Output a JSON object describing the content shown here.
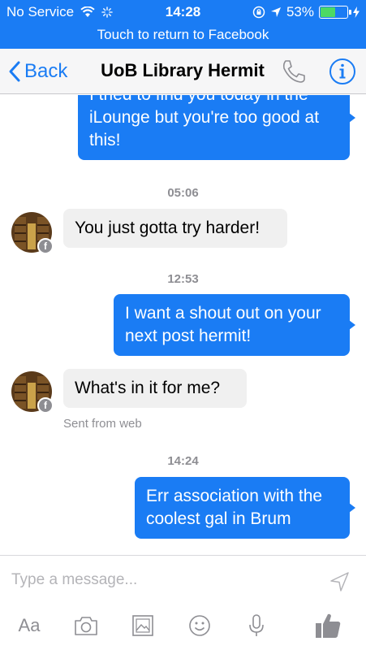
{
  "status_bar": {
    "carrier": "No Service",
    "time": "14:28",
    "battery": "53%",
    "battery_level": 0.53
  },
  "return_banner": "Touch to return to Facebook",
  "nav": {
    "back_label": "Back",
    "title": "UoB Library Hermit"
  },
  "messages": [
    {
      "from": "me",
      "text": "I tried to find you today in the iLounge but you're too good at this!"
    },
    {
      "type": "timestamp",
      "text": "05:06"
    },
    {
      "from": "them",
      "text": "You just gotta try harder!"
    },
    {
      "type": "timestamp",
      "text": "12:53"
    },
    {
      "from": "me",
      "text": "I want a shout out on your next post hermit!"
    },
    {
      "from": "them",
      "text": "What's in it for me?",
      "note": "Sent from web"
    },
    {
      "type": "timestamp",
      "text": "14:24"
    },
    {
      "from": "me",
      "text": "Err association with the coolest gal in Brum"
    }
  ],
  "composer": {
    "placeholder": "Type a message...",
    "aa_label": "Aa"
  },
  "colors": {
    "accent": "#1a7cf4",
    "incoming_bubble": "#f0f0f0",
    "muted": "#8e8e93"
  }
}
